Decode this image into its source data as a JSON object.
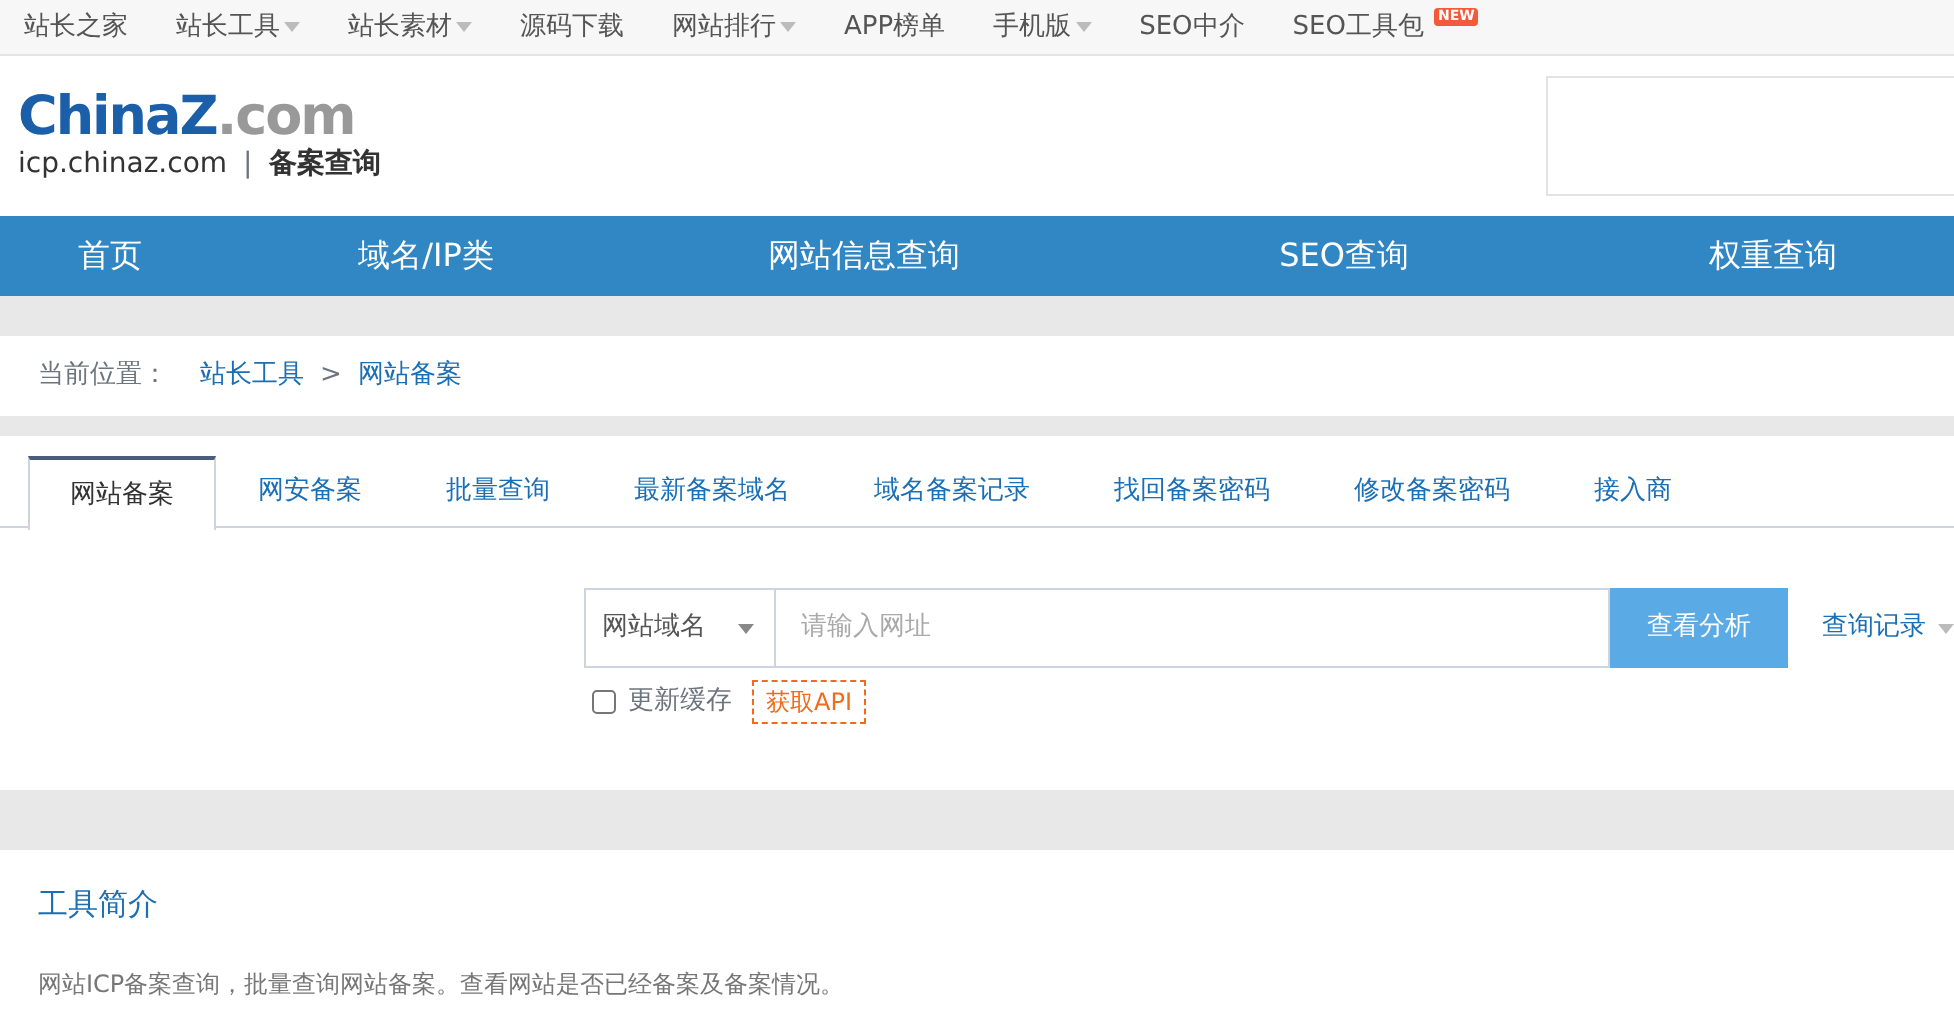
{
  "top_links": [
    {
      "label": "站长之家",
      "dropdown": false
    },
    {
      "label": "站长工具",
      "dropdown": true
    },
    {
      "label": "站长素材",
      "dropdown": true
    },
    {
      "label": "源码下载",
      "dropdown": false
    },
    {
      "label": "网站排行",
      "dropdown": true
    },
    {
      "label": "APP榜单",
      "dropdown": false
    },
    {
      "label": "手机版",
      "dropdown": true
    },
    {
      "label": "SEO中介",
      "dropdown": false
    },
    {
      "label": "SEO工具包",
      "dropdown": false,
      "badge": "NEW"
    }
  ],
  "logo": {
    "brand": "China",
    "brand_mark": "Z",
    "brand_suffix": ".com",
    "domain": "icp.chinaz.com",
    "divider": "|",
    "product": "备案查询"
  },
  "main_nav": [
    "首页",
    "域名/IP类",
    "网站信息查询",
    "SEO查询",
    "权重查询"
  ],
  "breadcrumb": {
    "label": "当前位置：",
    "items": [
      "站长工具",
      "网站备案"
    ],
    "separator": ">"
  },
  "tabs": [
    {
      "label": "网站备案",
      "selected": true
    },
    {
      "label": "网安备案",
      "selected": false
    },
    {
      "label": "批量查询",
      "selected": false
    },
    {
      "label": "最新备案域名",
      "selected": false
    },
    {
      "label": "域名备案记录",
      "selected": false
    },
    {
      "label": "找回备案密码",
      "selected": false
    },
    {
      "label": "修改备案密码",
      "selected": false
    },
    {
      "label": "接入商",
      "selected": false
    }
  ],
  "search": {
    "type_select": "网站域名",
    "placeholder": "请输入网址",
    "button": "查看分析",
    "history": "查询记录",
    "refresh_cache": {
      "label": "更新缓存",
      "checked": false
    },
    "api_link": "获取API"
  },
  "intro": {
    "title": "工具简介",
    "text": "网站ICP备案查询，批量查询网站备案。查看网站是否已经备案及备案情况。"
  }
}
